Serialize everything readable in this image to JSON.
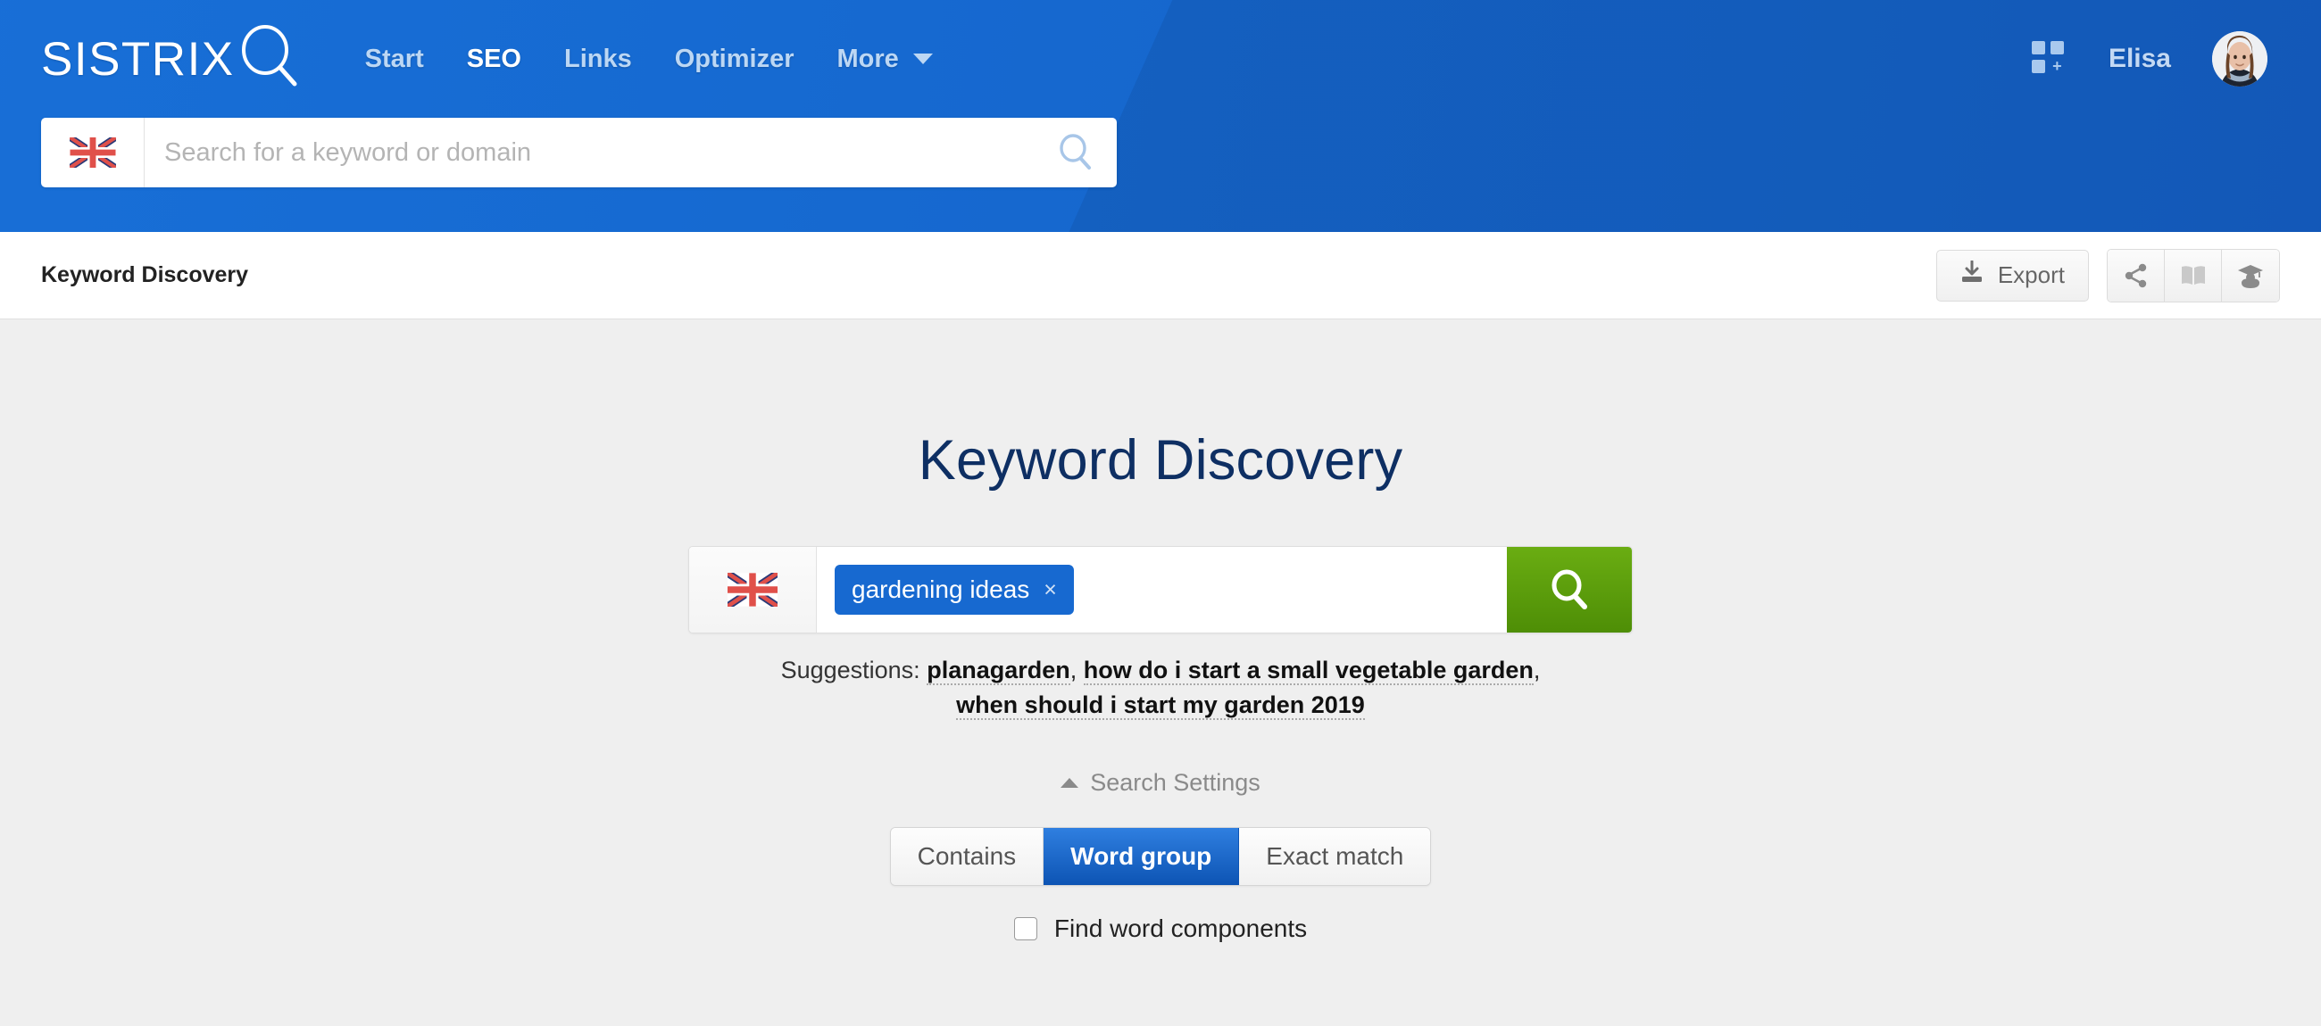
{
  "colors": {
    "header_blue": "#1568cf",
    "accent_blue": "#1769d0",
    "active_nav_blue": "#0d54b4",
    "search_green": "#5b9f0b",
    "title_navy": "#0e2f63",
    "page_background": "#efefef"
  },
  "header": {
    "logo_text": "SISTRIX",
    "logo_icon": "magnifier-icon",
    "nav": [
      {
        "label": "Start",
        "active": false
      },
      {
        "label": "SEO",
        "active": true
      },
      {
        "label": "Links",
        "active": false
      },
      {
        "label": "Optimizer",
        "active": false
      },
      {
        "label": "More",
        "active": false,
        "has_caret": true
      }
    ],
    "apps_icon": "apps-grid-plus-icon",
    "user_name": "Elisa",
    "avatar_icon": "user-avatar"
  },
  "top_search": {
    "flag_icon": "uk-flag-icon",
    "value": "",
    "placeholder": "Search for a keyword or domain",
    "search_icon": "search-icon"
  },
  "subheader": {
    "title": "Keyword Discovery",
    "export_label": "Export",
    "export_icon": "download-icon",
    "tools": [
      {
        "name": "share-icon",
        "label": "Share"
      },
      {
        "name": "book-icon",
        "label": "Documentation"
      },
      {
        "name": "graduation-cap-icon",
        "label": "Academy"
      }
    ]
  },
  "main": {
    "page_title": "Keyword Discovery",
    "keyword_search": {
      "flag_icon": "uk-flag-icon",
      "tag": "gardening ideas",
      "tag_remove_icon": "×",
      "go_icon": "search-icon"
    },
    "suggestions": {
      "label": "Suggestions:",
      "items": [
        "planagarden",
        "how do i start a small vegetable garden",
        "when should i start my garden 2019"
      ],
      "separator": ", "
    },
    "search_settings": {
      "label": "Search Settings",
      "caret_icon": "caret-up-icon",
      "expanded": true
    },
    "match_modes": [
      {
        "label": "Contains",
        "active": false
      },
      {
        "label": "Word group",
        "active": true
      },
      {
        "label": "Exact match",
        "active": false
      }
    ],
    "find_word_components": {
      "label": "Find word components",
      "checked": false
    }
  }
}
